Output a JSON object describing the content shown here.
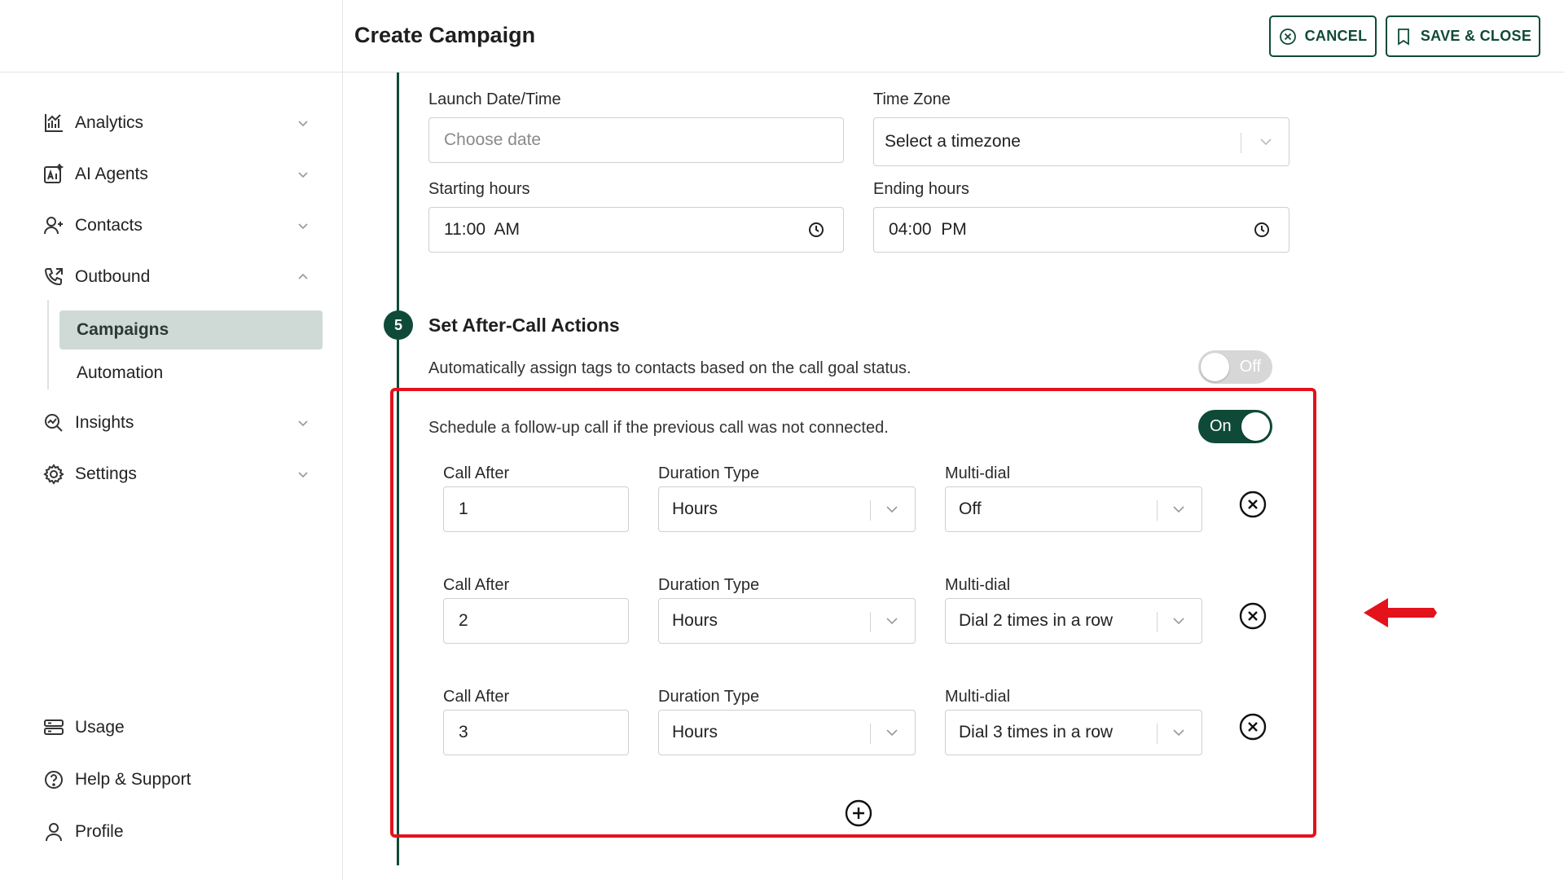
{
  "header": {
    "title": "Create Campaign",
    "cancel_label": "CANCEL",
    "save_close_label": "SAVE & CLOSE"
  },
  "sidebar": {
    "items": [
      {
        "label": "Analytics",
        "icon": "analytics-icon"
      },
      {
        "label": "AI Agents",
        "icon": "ai-agents-icon"
      },
      {
        "label": "Contacts",
        "icon": "add-contact-icon"
      },
      {
        "label": "Outbound",
        "icon": "phone-outbound-icon"
      },
      {
        "label": "Insights",
        "icon": "insights-icon"
      },
      {
        "label": "Settings",
        "icon": "gear-icon"
      }
    ],
    "subitems": [
      {
        "label": "Campaigns",
        "active": true
      },
      {
        "label": "Automation",
        "active": false
      }
    ],
    "bottom": [
      {
        "label": "Usage",
        "icon": "usage-icon"
      },
      {
        "label": "Help & Support",
        "icon": "help-icon"
      },
      {
        "label": "Profile",
        "icon": "profile-icon"
      }
    ]
  },
  "schedule": {
    "launch_label": "Launch Date/Time",
    "launch_placeholder": "Choose date",
    "timezone_label": "Time Zone",
    "timezone_value": "Select a timezone",
    "start_label": "Starting hours",
    "start_value": "11:00  AM",
    "end_label": "Ending hours",
    "end_value": "04:00  PM"
  },
  "after_call": {
    "step_number": "5",
    "title": "Set After-Call Actions",
    "auto_tag_text": "Automatically assign tags to contacts based on the call goal status.",
    "auto_tag_toggle": "Off",
    "followup_text": "Schedule a follow-up call if the previous call was not connected.",
    "followup_toggle": "On",
    "rows": [
      {
        "call_after_label": "Call After",
        "call_after": "1",
        "duration_label": "Duration Type",
        "duration": "Hours",
        "multidial_label": "Multi-dial",
        "multidial": "Off"
      },
      {
        "call_after_label": "Call After",
        "call_after": "2",
        "duration_label": "Duration Type",
        "duration": "Hours",
        "multidial_label": "Multi-dial",
        "multidial": "Dial 2 times in a row"
      },
      {
        "call_after_label": "Call After",
        "call_after": "3",
        "duration_label": "Duration Type",
        "duration": "Hours",
        "multidial_label": "Multi-dial",
        "multidial": "Dial 3 times in a row"
      }
    ]
  },
  "colors": {
    "brand": "#0f4a38",
    "highlight": "#e3121b",
    "active_nav_bg": "#cfdad6"
  }
}
